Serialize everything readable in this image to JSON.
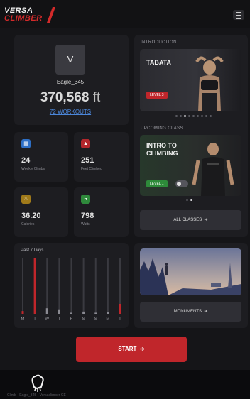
{
  "header": {
    "logo_line1": "VERSA",
    "logo_line2": "CLIMBER",
    "menu_icon": "hamburger-icon"
  },
  "profile": {
    "avatar_initial": "V",
    "username": "Eagle_345",
    "distance_value": "370,568",
    "distance_unit": "ft",
    "workouts_link": "72 WORKOUTS"
  },
  "stats": [
    {
      "icon": "calendar-icon",
      "color": "#2d6fc6",
      "value": "24",
      "label": "Weekly Climbs"
    },
    {
      "icon": "mountain-icon",
      "color": "#b3272c",
      "value": "251",
      "label": "Feet Climbed"
    },
    {
      "icon": "flame-icon",
      "color": "#a07a1a",
      "value": "36.20",
      "label": "Calories"
    },
    {
      "icon": "bolt-icon",
      "color": "#2f8a3c",
      "value": "798",
      "label": "Watts"
    }
  ],
  "past_chart": {
    "title": "Past 7 Days",
    "chart_data": {
      "type": "bar",
      "categories": [
        "M",
        "T",
        "W",
        "T",
        "F",
        "S",
        "S",
        "M",
        "T"
      ],
      "values": [
        0.05,
        1.0,
        0.1,
        0.08,
        0.02,
        0.04,
        0.02,
        0.03,
        0.18
      ],
      "highlight": [
        true,
        true,
        false,
        false,
        false,
        false,
        false,
        false,
        true
      ],
      "ylim": [
        0,
        1
      ]
    },
    "day_labels": [
      "M",
      "T",
      "W",
      "T",
      "F",
      "S",
      "S",
      "M",
      "T"
    ]
  },
  "introduction": {
    "section_title": "INTRODUCTION",
    "class_name": "TABATA",
    "level": "LEVEL 3",
    "level_color": "#c0262b",
    "dots": 9,
    "active_dot": 2
  },
  "upcoming": {
    "section_title": "UPCOMING CLASS",
    "class_name_line1": "INTRO TO",
    "class_name_line2": "CLIMBING",
    "level": "LEVEL 1",
    "level_color": "#2e8b3a",
    "dots": 2,
    "active_dot": 1,
    "all_classes_label": "ALL CLASSES"
  },
  "monuments": {
    "label": "MONUMENTS"
  },
  "start_label": "START",
  "footer": {
    "text": "Climb · Eagle_345 · Versaclimber CE",
    "icon": "gesture-hand-icon"
  }
}
